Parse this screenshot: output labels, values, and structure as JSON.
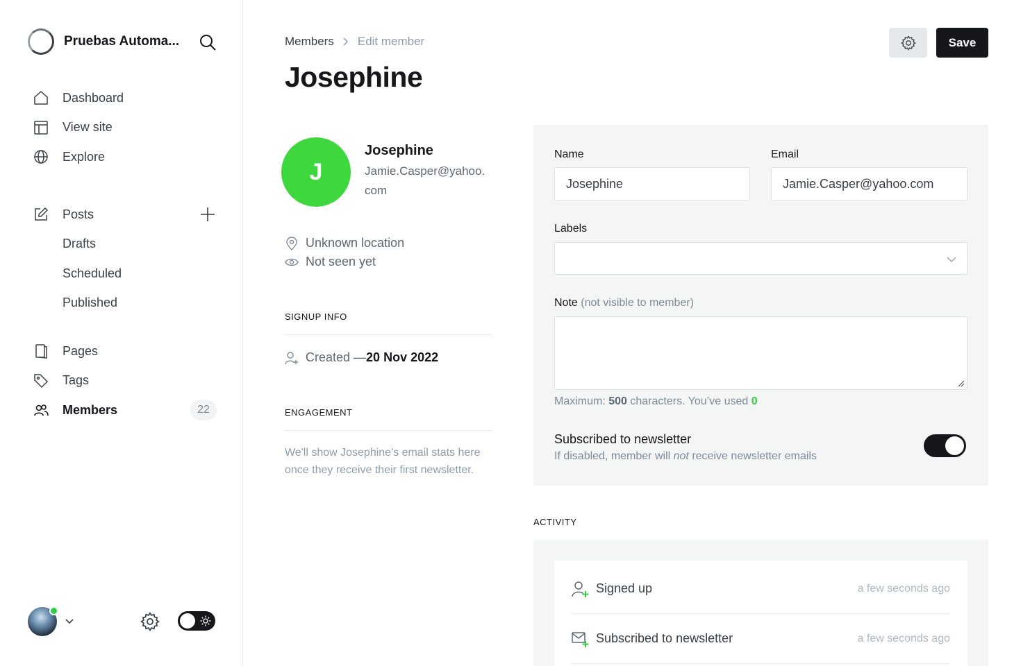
{
  "sidebar": {
    "site_name": "Pruebas Automa...",
    "nav": [
      {
        "label": "Dashboard",
        "icon": "home-icon"
      },
      {
        "label": "View site",
        "icon": "layout-icon"
      },
      {
        "label": "Explore",
        "icon": "globe-icon"
      }
    ],
    "posts": {
      "label": "Posts",
      "icon": "edit-icon"
    },
    "post_subitems": [
      {
        "label": "Drafts"
      },
      {
        "label": "Scheduled"
      },
      {
        "label": "Published"
      }
    ],
    "pages": {
      "label": "Pages",
      "icon": "page-icon"
    },
    "tags": {
      "label": "Tags",
      "icon": "tag-icon"
    },
    "members": {
      "label": "Members",
      "icon": "members-icon",
      "count": "22"
    }
  },
  "header": {
    "breadcrumb_parent": "Members",
    "breadcrumb_current": "Edit member",
    "title": "Josephine",
    "save_label": "Save"
  },
  "member": {
    "initial": "J",
    "avatar_color": "#3ed83e",
    "name": "Josephine",
    "email": "Jamie.Casper@yahoo.com",
    "location": "Unknown location",
    "last_seen": "Not seen yet",
    "signup_info_label": "SIGNUP INFO",
    "created_prefix": "Created — ",
    "created_date": "20 Nov 2022",
    "engagement_label": "ENGAGEMENT",
    "engagement_text": "We'll show Josephine's email stats here once they receive their first newsletter."
  },
  "form": {
    "name_label": "Name",
    "name_value": "Josephine",
    "email_label": "Email",
    "email_value": "Jamie.Casper@yahoo.com",
    "labels_label": "Labels",
    "note_label": "Note",
    "note_sublabel": "(not visible to member)",
    "hint_prefix": "Maximum: ",
    "hint_max": "500",
    "hint_middle": " characters. You’ve used ",
    "hint_used": "0",
    "newsletter_title": "Subscribed to newsletter",
    "newsletter_sub_prefix": "If disabled, member will ",
    "newsletter_sub_em": "not",
    "newsletter_sub_suffix": " receive newsletter emails",
    "newsletter_enabled": true
  },
  "activity": {
    "label": "ACTIVITY",
    "items": [
      {
        "text": "Signed up",
        "time": "a few seconds ago",
        "icon": "user-add-icon"
      },
      {
        "text": "Subscribed to newsletter",
        "time": "a few seconds ago",
        "icon": "mail-add-icon"
      }
    ]
  }
}
